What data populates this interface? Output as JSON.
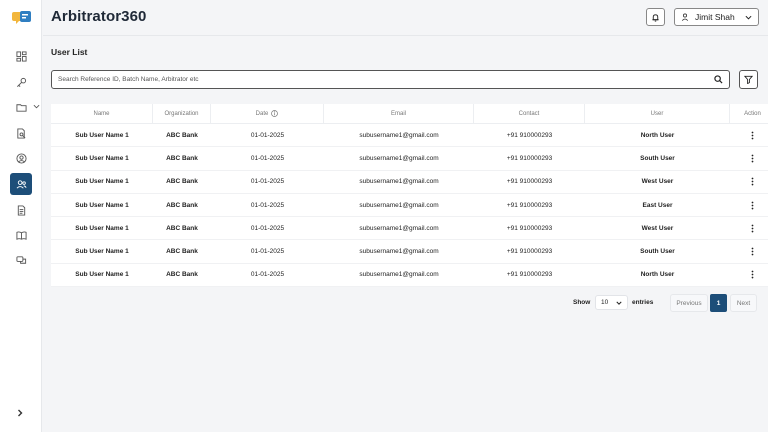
{
  "app": {
    "title": "Arbitrator360"
  },
  "sidebar": {
    "items": [
      {
        "icon": "dashboard-icon"
      },
      {
        "icon": "key-icon"
      },
      {
        "icon": "folder-icon",
        "has_submenu": true
      },
      {
        "icon": "document-search-icon"
      },
      {
        "icon": "user-circle-icon"
      },
      {
        "icon": "users-icon",
        "active": true
      },
      {
        "icon": "file-text-icon"
      },
      {
        "icon": "book-icon"
      },
      {
        "icon": "chat-icon"
      }
    ]
  },
  "header": {
    "user_name": "Jimit Shah"
  },
  "page": {
    "title": "User List"
  },
  "search": {
    "placeholder": "Search Reference ID, Batch Name, Arbitrator etc"
  },
  "table": {
    "headers": [
      "Name",
      "Organization",
      "Date",
      "Email",
      "Contact",
      "User",
      "Action"
    ],
    "rows": [
      {
        "name": "Sub User Name 1",
        "org": "ABC Bank",
        "date": "01-01-2025",
        "email": "subusername1@gmail.com",
        "contact": "+91 910000293",
        "user": "North User"
      },
      {
        "name": "Sub User Name 1",
        "org": "ABC Bank",
        "date": "01-01-2025",
        "email": "subusername1@gmail.com",
        "contact": "+91 910000293",
        "user": "South User"
      },
      {
        "name": "Sub User Name 1",
        "org": "ABC Bank",
        "date": "01-01-2025",
        "email": "subusername1@gmail.com",
        "contact": "+91 910000293",
        "user": "West User"
      },
      {
        "name": "Sub User Name 1",
        "org": "ABC Bank",
        "date": "01-01-2025",
        "email": "subusername1@gmail.com",
        "contact": "+91 910000293",
        "user": "East User"
      },
      {
        "name": "Sub User Name 1",
        "org": "ABC Bank",
        "date": "01-01-2025",
        "email": "subusername1@gmail.com",
        "contact": "+91 910000293",
        "user": "West User"
      },
      {
        "name": "Sub User Name 1",
        "org": "ABC Bank",
        "date": "01-01-2025",
        "email": "subusername1@gmail.com",
        "contact": "+91 910000293",
        "user": "South User"
      },
      {
        "name": "Sub User Name 1",
        "org": "ABC Bank",
        "date": "01-01-2025",
        "email": "subusername1@gmail.com",
        "contact": "+91 910000293",
        "user": "North User"
      }
    ]
  },
  "pagination": {
    "show_label": "Show",
    "entries_value": "10",
    "entries_label": "entries",
    "prev_label": "Previous",
    "current_page": "1",
    "next_label": "Next"
  },
  "colors": {
    "primary": "#1d4e79",
    "logo_yellow": "#f2b63c",
    "logo_blue": "#2f7ec1"
  }
}
